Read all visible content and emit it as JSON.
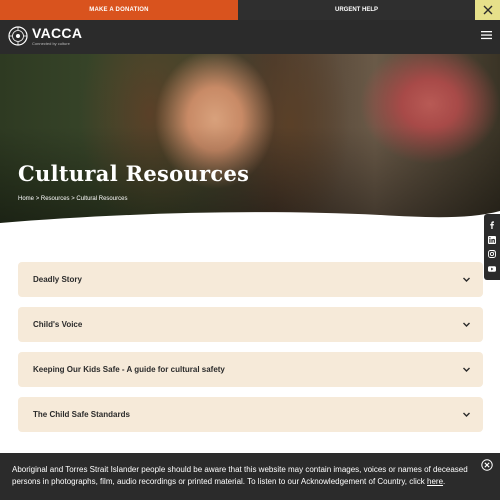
{
  "topbar": {
    "donate_label": "MAKE A DONATION",
    "urgent_label": "URGENT HELP",
    "close_icon": "close-icon"
  },
  "header": {
    "logo_name": "VACCA",
    "logo_tagline": "Connected by culture",
    "menu_icon": "hamburger-menu-icon"
  },
  "hero": {
    "title": "Cultural Resources",
    "breadcrumb": [
      "Home",
      "Resources",
      "Cultural Resources"
    ],
    "breadcrumb_separator": ">"
  },
  "social": [
    "facebook-icon",
    "linkedin-icon",
    "instagram-icon",
    "youtube-icon"
  ],
  "accordion": [
    {
      "label": "Deadly Story"
    },
    {
      "label": "Child's Voice"
    },
    {
      "label": "Keeping Our Kids Safe - A guide for cultural safety"
    },
    {
      "label": "The Child Safe Standards"
    }
  ],
  "cookie": {
    "text": "Aboriginal and Torres Strait Islander people should be aware that this website may contain images, voices or names of deceased persons in photographs, film, audio recordings or printed material. To listen to our Acknowledgement of Country, click ",
    "link": "here",
    "end": "."
  },
  "colors": {
    "donate_bg": "#d9531e",
    "dark_bg": "#2b2b2b",
    "close_bg": "#e6e08a",
    "accordion_bg": "#f6ead9"
  }
}
